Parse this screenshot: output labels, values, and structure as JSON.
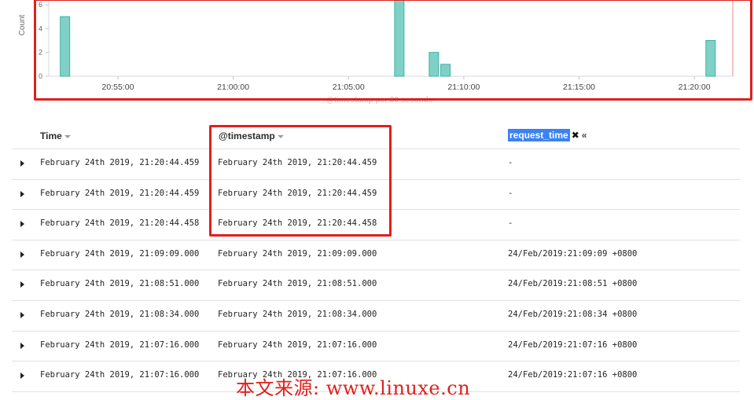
{
  "chart": {
    "ylabel": "Count",
    "subtitle": "@timestamp per 30 seconds",
    "bar_color": "#7fd1c7",
    "bar_stroke": "#3fb1a3",
    "cursor_color": "#e98a8a"
  },
  "chart_data": {
    "type": "bar",
    "title": "",
    "xlabel": "@timestamp per 30 seconds",
    "ylabel": "Count",
    "ylim": [
      0,
      6
    ],
    "y_ticks": [
      0,
      2,
      4,
      6
    ],
    "x_ticks": [
      "20:55:00",
      "21:00:00",
      "21:05:00",
      "21:10:00",
      "21:15:00",
      "21:20:00"
    ],
    "x_range_minutes": [
      20.8667,
      21.3611
    ],
    "bars": [
      {
        "time": "20:52:30",
        "value": 5
      },
      {
        "time": "21:07:00",
        "value": 6.5
      },
      {
        "time": "21:08:30",
        "value": 2
      },
      {
        "time": "21:09:00",
        "value": 1
      },
      {
        "time": "21:20:30",
        "value": 3
      }
    ],
    "grid": false,
    "legend": "none"
  },
  "table": {
    "headers": {
      "time": "Time",
      "timestamp": "@timestamp",
      "request_time": "request_time"
    },
    "rows": [
      {
        "time": "February 24th 2019, 21:20:44.459",
        "timestamp": "February 24th 2019, 21:20:44.459",
        "request_time": "-"
      },
      {
        "time": "February 24th 2019, 21:20:44.459",
        "timestamp": "February 24th 2019, 21:20:44.459",
        "request_time": "-"
      },
      {
        "time": "February 24th 2019, 21:20:44.458",
        "timestamp": "February 24th 2019, 21:20:44.458",
        "request_time": "-"
      },
      {
        "time": "February 24th 2019, 21:09:09.000",
        "timestamp": "February 24th 2019, 21:09:09.000",
        "request_time": "24/Feb/2019:21:09:09 +0800"
      },
      {
        "time": "February 24th 2019, 21:08:51.000",
        "timestamp": "February 24th 2019, 21:08:51.000",
        "request_time": "24/Feb/2019:21:08:51 +0800"
      },
      {
        "time": "February 24th 2019, 21:08:34.000",
        "timestamp": "February 24th 2019, 21:08:34.000",
        "request_time": "24/Feb/2019:21:08:34 +0800"
      },
      {
        "time": "February 24th 2019, 21:07:16.000",
        "timestamp": "February 24th 2019, 21:07:16.000",
        "request_time": "24/Feb/2019:21:07:16 +0800"
      },
      {
        "time": "February 24th 2019, 21:07:16.000",
        "timestamp": "February 24th 2019, 21:07:16.000",
        "request_time": "24/Feb/2019:21:07:16 +0800"
      }
    ]
  },
  "watermark": "本文来源: www.linuxe.cn",
  "icons": {
    "sort": "caret-down-icon",
    "remove_column": "close-icon",
    "move_left": "double-chevron-left-icon",
    "expand_row": "caret-right-icon"
  },
  "colors": {
    "highlight_box": "#e0201c",
    "selected_header": "#3b82f6"
  }
}
